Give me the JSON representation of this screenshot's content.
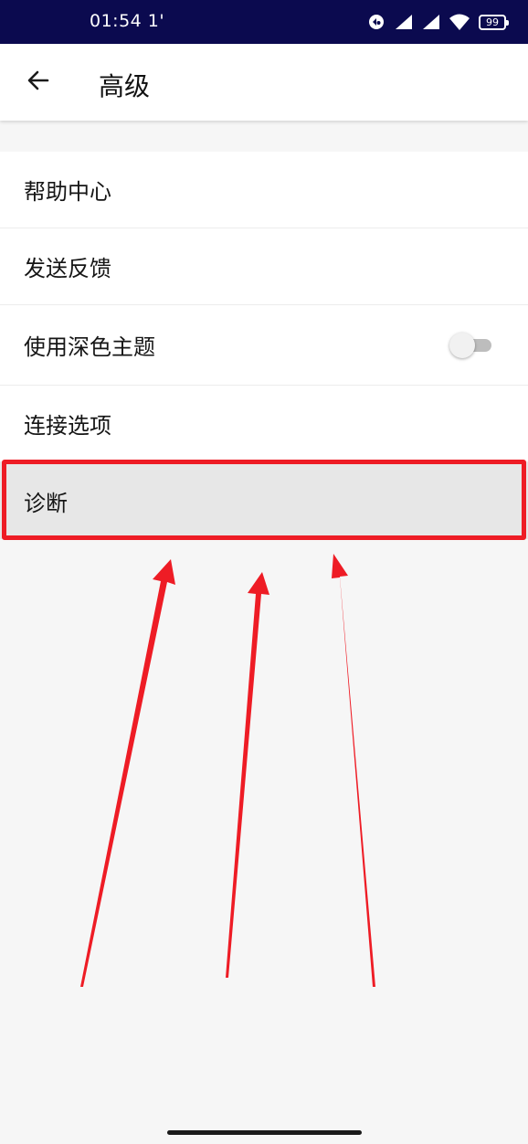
{
  "status_bar": {
    "time": "01:54 1'",
    "battery": "99",
    "icons": [
      "sync-icon",
      "signal-icon",
      "signal-icon",
      "wifi-icon",
      "battery-icon"
    ]
  },
  "header": {
    "back_icon": "arrow-left-icon",
    "title": "高级"
  },
  "menu": {
    "items": [
      {
        "label": "帮助中心"
      },
      {
        "label": "发送反馈"
      },
      {
        "label": "使用深色主题",
        "toggle": false
      },
      {
        "label": "连接选项"
      },
      {
        "label": "诊断",
        "highlighted": true
      }
    ]
  },
  "annotation": {
    "color": "#ee1c25",
    "arrow_count": 3
  }
}
